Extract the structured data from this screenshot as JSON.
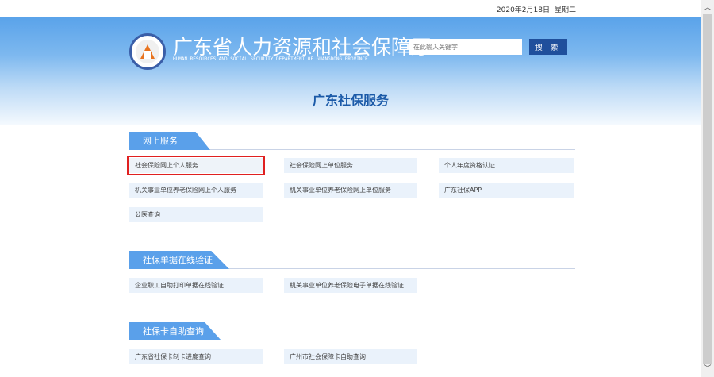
{
  "topbar": {
    "date": "2020年2月18日",
    "weekday": "星期二"
  },
  "header": {
    "title": "广东省人力资源和社会保障厅",
    "subtitle": "HUMAN RESOURCES AND SOCIAL SECURITY DEPARTMENT OF GUANGDONG PROVINCE",
    "search_placeholder": "在此输入关键字",
    "search_button": "搜 索"
  },
  "page_title": "广东社保服务",
  "sections": [
    {
      "title": "网上服务",
      "items": [
        "社会保险网上个人服务",
        "社会保险网上单位服务",
        "个人年度资格认证",
        "机关事业单位养老保险网上个人服务",
        "机关事业单位养老保险网上单位服务",
        "广东社保APP",
        "公医查询"
      ]
    },
    {
      "title": "社保单据在线验证",
      "items": [
        "企业职工自助打印单据在线验证",
        "机关事业单位养老保险电子单据在线验证"
      ]
    },
    {
      "title": "社保卡自助查询",
      "items": [
        "广东省社保卡制卡进度查询",
        "广州市社会保障卡自助查询"
      ]
    }
  ],
  "highlight_color": "#e02020",
  "accent_color": "#5aa0ea"
}
